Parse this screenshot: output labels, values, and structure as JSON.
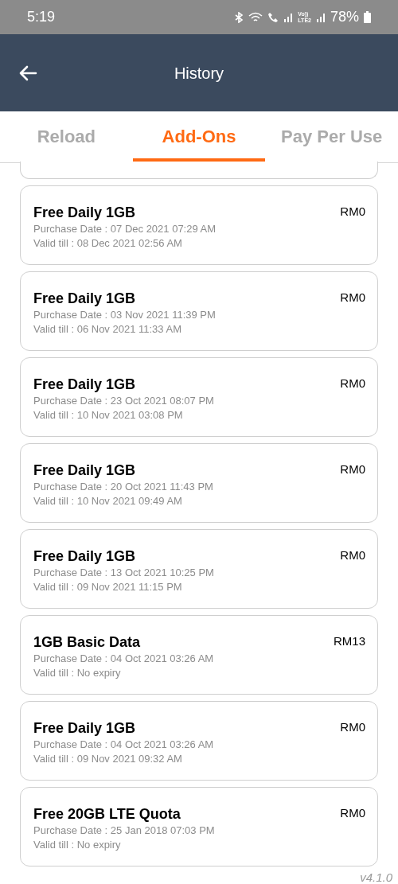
{
  "status_bar": {
    "time": "5:19",
    "network_label": [
      "Vo))",
      "LTE2"
    ],
    "battery": "78%"
  },
  "header": {
    "title": "History"
  },
  "tabs": [
    {
      "label": "Reload",
      "selected": false
    },
    {
      "label": "Add-Ons",
      "selected": true
    },
    {
      "label": "Pay Per Use",
      "selected": false
    }
  ],
  "items": [
    {
      "name": "Free Daily 1GB",
      "price": "RM0",
      "purchase": "Purchase Date : 07 Dec 2021 07:29 AM",
      "valid": "Valid till : 08 Dec 2021 02:56 AM"
    },
    {
      "name": "Free Daily 1GB",
      "price": "RM0",
      "purchase": "Purchase Date : 03 Nov 2021 11:39 PM",
      "valid": "Valid till : 06 Nov 2021 11:33 AM"
    },
    {
      "name": "Free Daily 1GB",
      "price": "RM0",
      "purchase": "Purchase Date : 23 Oct 2021 08:07 PM",
      "valid": "Valid till : 10 Nov 2021 03:08 PM"
    },
    {
      "name": "Free Daily 1GB",
      "price": "RM0",
      "purchase": "Purchase Date : 20 Oct 2021 11:43 PM",
      "valid": "Valid till : 10 Nov 2021 09:49 AM"
    },
    {
      "name": "Free Daily 1GB",
      "price": "RM0",
      "purchase": "Purchase Date : 13 Oct 2021 10:25 PM",
      "valid": "Valid till : 09 Nov 2021 11:15 PM"
    },
    {
      "name": "1GB Basic Data",
      "price": "RM13",
      "purchase": "Purchase Date : 04 Oct 2021 03:26 AM",
      "valid": "Valid till : No expiry"
    },
    {
      "name": "Free Daily 1GB",
      "price": "RM0",
      "purchase": "Purchase Date : 04 Oct 2021 03:26 AM",
      "valid": "Valid till : 09 Nov 2021 09:32 AM"
    },
    {
      "name": "Free 20GB LTE Quota",
      "price": "RM0",
      "purchase": "Purchase Date : 25 Jan 2018 07:03 PM",
      "valid": "Valid till : No expiry"
    }
  ],
  "version": "v4.1.0"
}
